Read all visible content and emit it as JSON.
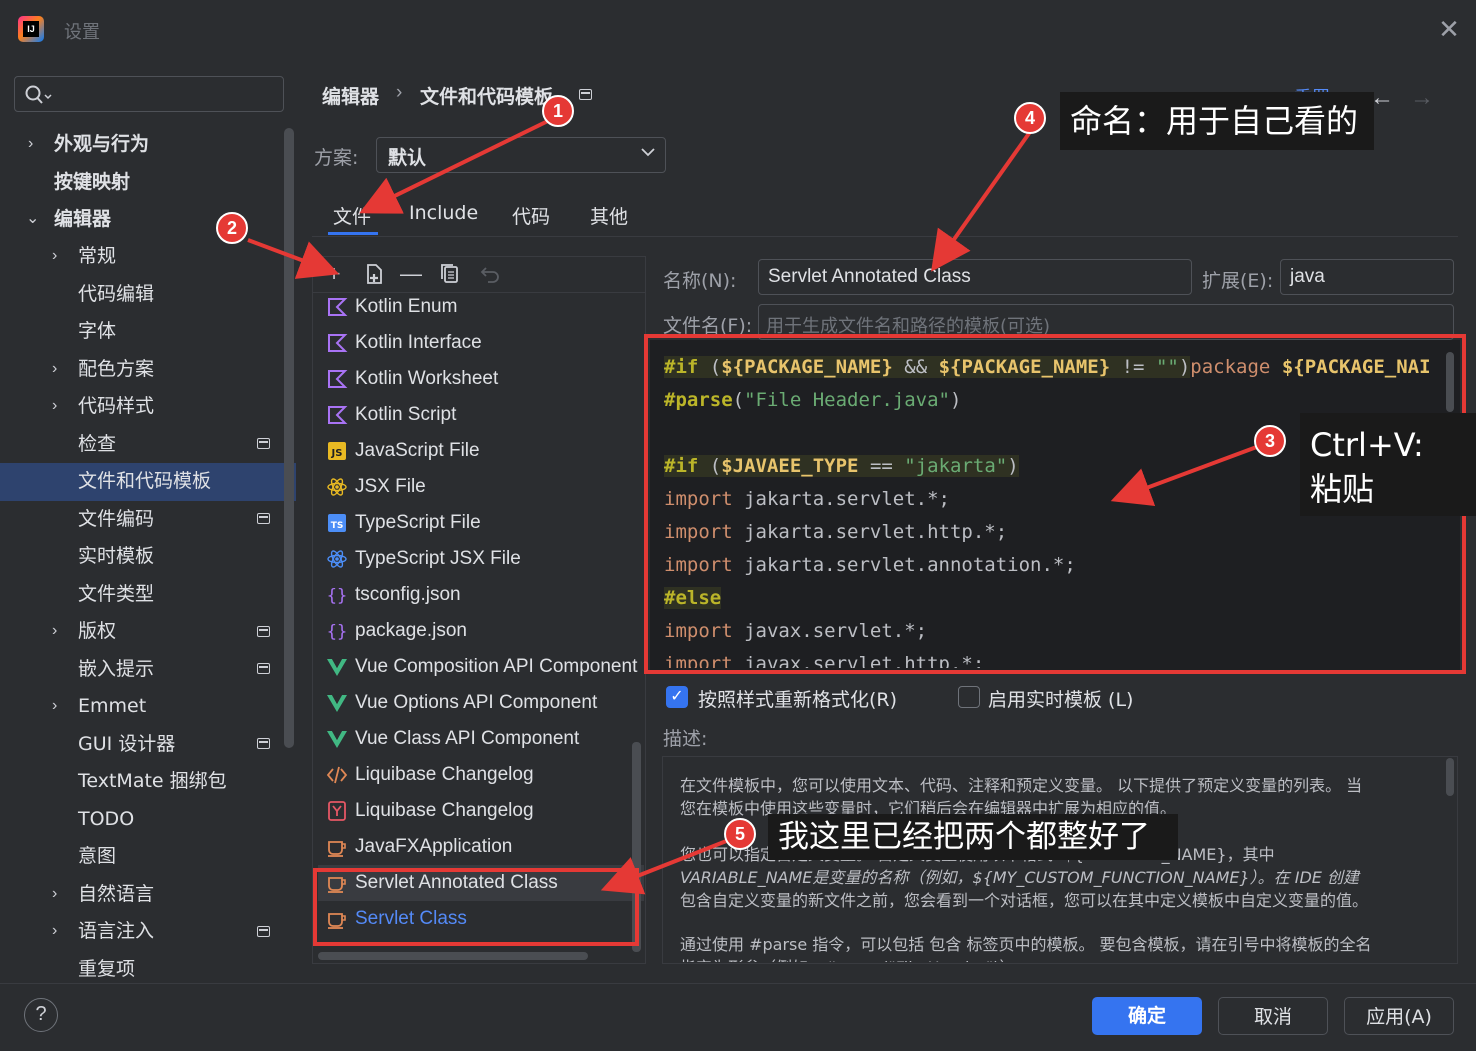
{
  "window": {
    "title": "设置"
  },
  "nav": {
    "search_placeholder": "",
    "items": [
      {
        "label": "外观与行为",
        "chevron": "›"
      },
      {
        "label": "按键映射"
      },
      {
        "label": "编辑器",
        "chevron": "⌄"
      },
      {
        "label": "常规",
        "chevron": "›"
      },
      {
        "label": "代码编辑"
      },
      {
        "label": "字体"
      },
      {
        "label": "配色方案",
        "chevron": "›"
      },
      {
        "label": "代码样式",
        "chevron": "›"
      },
      {
        "label": "检查"
      },
      {
        "label": "文件和代码模板"
      },
      {
        "label": "文件编码"
      },
      {
        "label": "实时模板"
      },
      {
        "label": "文件类型"
      },
      {
        "label": "版权",
        "chevron": "›"
      },
      {
        "label": "嵌入提示"
      },
      {
        "label": "Emmet",
        "chevron": "›"
      },
      {
        "label": "GUI 设计器"
      },
      {
        "label": "TextMate 捆绑包"
      },
      {
        "label": "TODO"
      },
      {
        "label": "意图"
      },
      {
        "label": "自然语言",
        "chevron": "›"
      },
      {
        "label": "语言注入",
        "chevron": "›"
      },
      {
        "label": "重复项"
      }
    ]
  },
  "breadcrumb": {
    "parent": "编辑器",
    "separator": "›",
    "current": "文件和代码模板"
  },
  "header": {
    "reset": "重置",
    "back": "←",
    "forward": "→"
  },
  "scheme": {
    "label": "方案:",
    "value": "默认"
  },
  "tabs": [
    "文件",
    "Include",
    "代码",
    "其他"
  ],
  "toolbar": {
    "add": "+",
    "remove": "—"
  },
  "template_list": [
    {
      "label": "Kotlin Enum",
      "icon": "kotlin-icon"
    },
    {
      "label": "Kotlin Interface",
      "icon": "kotlin-icon"
    },
    {
      "label": "Kotlin Worksheet",
      "icon": "kotlin-icon"
    },
    {
      "label": "Kotlin Script",
      "icon": "kotlin-icon"
    },
    {
      "label": "JavaScript File",
      "icon": "javascript-icon"
    },
    {
      "label": "JSX File",
      "icon": "react-icon"
    },
    {
      "label": "TypeScript File",
      "icon": "typescript-icon"
    },
    {
      "label": "TypeScript JSX File",
      "icon": "react-icon"
    },
    {
      "label": "tsconfig.json",
      "icon": "json-icon"
    },
    {
      "label": "package.json",
      "icon": "json-icon"
    },
    {
      "label": "Vue Composition API Component",
      "icon": "vue-icon"
    },
    {
      "label": "Vue Options API Component",
      "icon": "vue-icon"
    },
    {
      "label": "Vue Class API Component",
      "icon": "vue-icon"
    },
    {
      "label": "Liquibase Changelog",
      "icon": "liquibase-xml-icon"
    },
    {
      "label": "Liquibase Changelog",
      "icon": "liquibase-yaml-icon"
    },
    {
      "label": "JavaFXApplication",
      "icon": "java-cup-icon"
    },
    {
      "label": "Servlet Annotated Class",
      "icon": "java-cup-icon"
    },
    {
      "label": "Servlet Class",
      "icon": "java-cup-icon"
    }
  ],
  "fields": {
    "name_label": "名称(N):",
    "name_value": "Servlet Annotated Class",
    "ext_label": "扩展(E):",
    "ext_value": "java",
    "filename_label": "文件名(F):",
    "filename_placeholder": "用于生成文件名和路径的模板(可选)"
  },
  "code": {
    "l1_kw": "#if",
    "l1_a": " (",
    "l1_v1": "${PACKAGE_NAME}",
    "l1_b": " && ",
    "l1_v2": "${PACKAGE_NAME}",
    "l1_c": " != ",
    "l1_s": "\"\"",
    "l1_d": ")",
    "l1_pkg": "package",
    "l1_e": " ",
    "l1_v3": "${PACKAGE_NAI",
    "l2_kw": "#parse",
    "l2_a": "(",
    "l2_s": "\"File Header.java\"",
    "l2_b": ")",
    "l4_kw": "#if",
    "l4_a": " (",
    "l4_v": "$JAVAEE_TYPE",
    "l4_b": " == ",
    "l4_s": "\"jakarta\"",
    "l4_c": ")",
    "import_kw": "import",
    "l5": " jakarta.servlet.*;",
    "l6": " jakarta.servlet.http.*;",
    "l7": " jakarta.servlet.annotation.*;",
    "l8_kw": "#else",
    "l9": " javax.servlet.*;",
    "l10": " javax.servlet.http.*;"
  },
  "options": {
    "reformat_label": "按照样式重新格式化(R)",
    "reformat_checked": "✓",
    "live_label": "启用实时模板 (L)"
  },
  "description": {
    "label": "描述:",
    "p1_line1": "在文件模板中，您可以使用文本、代码、注释和预定义变量。 以下提供了预定义变量的列表。 当",
    "p1_line2": "您在模板中使用这些变量时，它们稍后会在编辑器中扩展为相应的值。",
    "p2_line1": "您也可以指定自定义变量。 自定义变量使用以下格式: ${VARIABLE_NAME}，其中",
    "p2_line2": "VARIABLE_NAME是变量的名称（例如，${MY_CUSTOM_FUNCTION_NAME}）。在 IDE 创建",
    "p2_line3": "包含自定义变量的新文件之前，您会看到一个对话框，您可以在其中定义模板中自定义变量的值。",
    "p3_line1": "通过使用 #parse 指令，可以包括 包含 标签页中的模板。 要包含模板，请在引号中将模板的全名",
    "p3_line2": "指定为形参（例如，#parse(\"File Header\")）。"
  },
  "footer": {
    "help": "?",
    "ok": "确定",
    "cancel": "取消",
    "apply": "应用(A)"
  },
  "annotations": {
    "badge1": "1",
    "badge2": "2",
    "badge3": "3",
    "badge4": "4",
    "badge5": "5",
    "callout3_line1": "Ctrl+V:",
    "callout3_line2": "粘贴",
    "callout4": "命名：用于自己看的",
    "callout5": "我这里已经把两个都整好了",
    "color": "#e53935"
  }
}
